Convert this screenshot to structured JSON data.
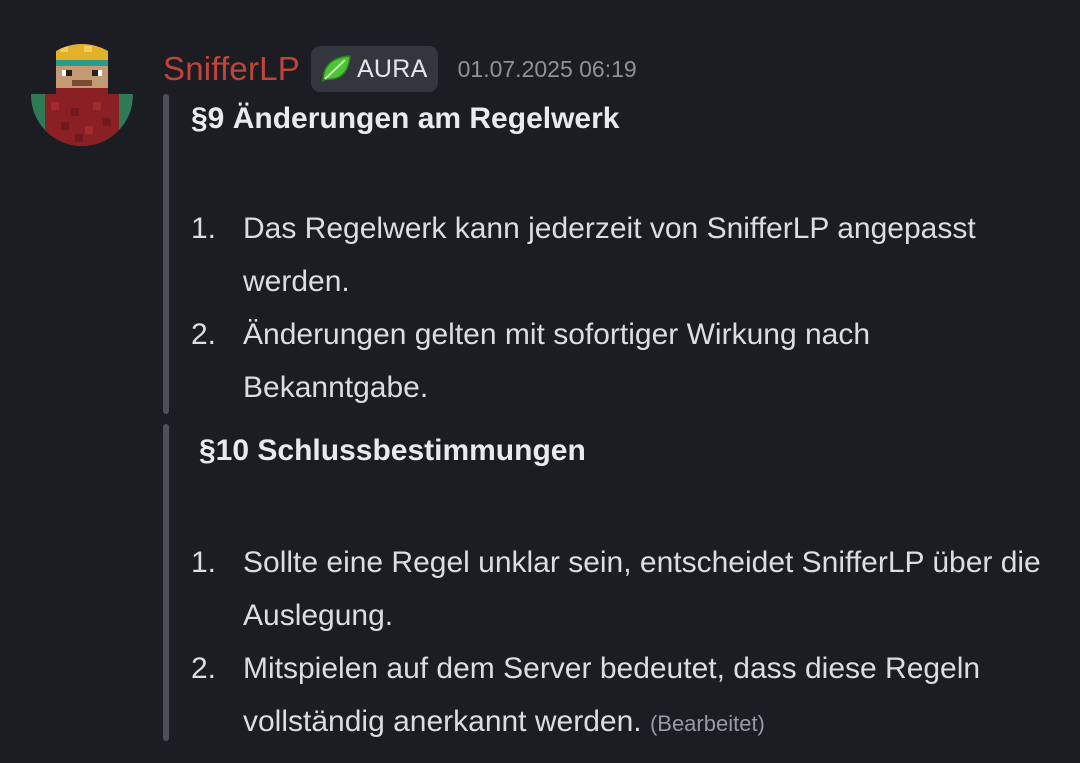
{
  "message": {
    "author": "SnifferLP",
    "role": {
      "label": "AURA",
      "icon": "leaf-icon"
    },
    "timestamp": "01.07.2025 06:19",
    "sections": [
      {
        "heading": "§9 Änderungen am Regelwerk",
        "items": [
          {
            "num": "1.",
            "text": "Das Regelwerk kann jederzeit von SnifferLP angepasst werden."
          },
          {
            "num": "2.",
            "text": "Änderungen gelten mit sofortiger Wirkung nach Bekanntgabe."
          }
        ]
      },
      {
        "heading": "§10 Schlussbestimmungen",
        "items": [
          {
            "num": "1.",
            "text": "Sollte eine Regel unklar sein, entscheidet SnifferLP über die Auslegung."
          },
          {
            "num": "2.",
            "text": "Mitspielen auf dem Server bedeutet, dass diese Regeln vollständig anerkannt werden."
          }
        ]
      }
    ],
    "edited_label": "(Bearbeitet)"
  },
  "colors": {
    "background": "#1c1d22",
    "username": "#c1443a",
    "role_tag_bg": "#34363d",
    "quote_bar": "#4e5058",
    "timestamp": "#8e9297"
  }
}
